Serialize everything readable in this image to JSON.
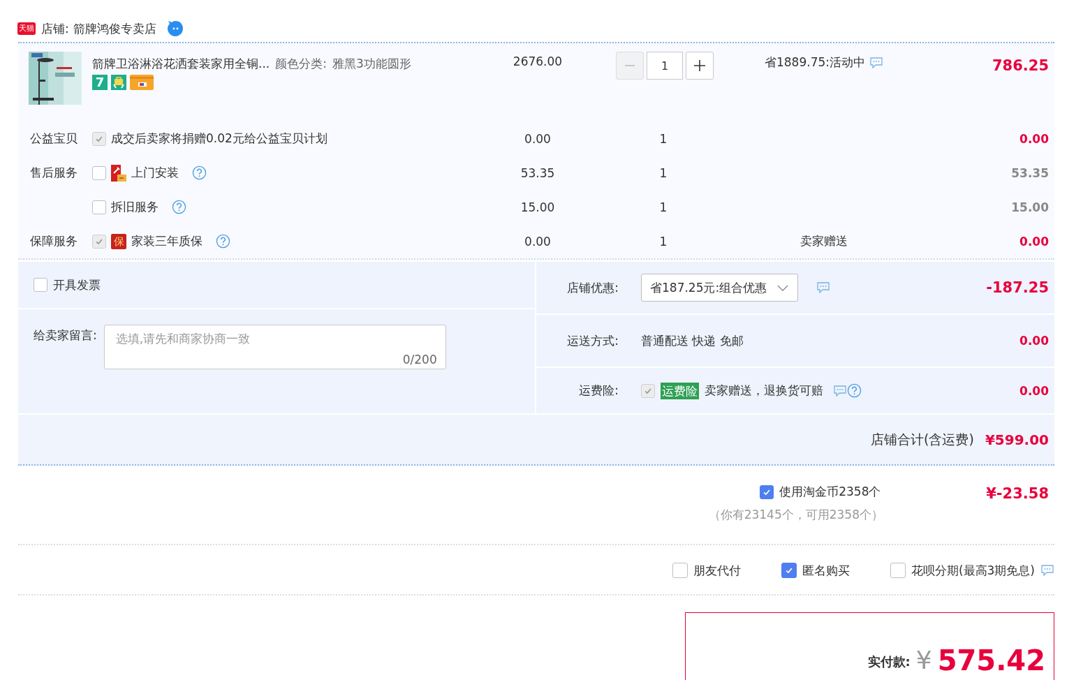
{
  "shop": {
    "badge": "天猫",
    "label": "店铺:",
    "name": "箭牌鸿俊专卖店"
  },
  "product": {
    "title": "箭牌卫浴淋浴花洒套装家用全铜...",
    "sku_label": "颜色分类:",
    "sku_value": "雅黑3功能圆形",
    "badge": "7",
    "price": "2676.00",
    "quantity": "1",
    "savings": "省1889.75:活动中",
    "total": "786.25"
  },
  "services": [
    {
      "group": "公益宝贝",
      "kind": "plain",
      "checked": true,
      "disabled": true,
      "label": "成交后卖家将捐赠0.02元给公益宝贝计划",
      "help": false,
      "price": "0.00",
      "quantity": "1",
      "total": "0.00"
    },
    {
      "group": "售后服务",
      "kind": "install",
      "checked": false,
      "disabled": false,
      "label": "上门安装",
      "help": true,
      "price": "53.35",
      "quantity": "1",
      "total": "53.35"
    },
    {
      "kind": "plain",
      "checked": false,
      "disabled": false,
      "label": "拆旧服务",
      "help": true,
      "price": "15.00",
      "quantity": "1",
      "total": "15.00"
    },
    {
      "group": "保障服务",
      "kind": "warranty",
      "badge": "保",
      "checked": true,
      "disabled": true,
      "label": "家装三年质保",
      "help": true,
      "price": "0.00",
      "quantity": "1",
      "note": "卖家赠送",
      "total": "0.00"
    }
  ],
  "invoice": {
    "label": "开具发票",
    "checked": false
  },
  "message": {
    "label": "给卖家留言:",
    "placeholder": "选填,请先和商家协商一致",
    "counter": "0/200"
  },
  "store_discount": {
    "label": "店铺优惠:",
    "value": "省187.25元:组合优惠",
    "amount": "-187.25"
  },
  "shipping": {
    "label": "运送方式:",
    "value": "普通配送 快递 免邮",
    "amount": "0.00"
  },
  "insurance": {
    "label": "运费险:",
    "checked": true,
    "disabled": true,
    "tag": "运费险",
    "text": "卖家赠送，退换货可赔",
    "amount": "0.00"
  },
  "shop_total": {
    "label": "店铺合计(含运费)",
    "amount": "¥599.00"
  },
  "coins": {
    "label": "使用淘金币2358个",
    "checked": true,
    "note": "（你有23145个，可用2358个）",
    "amount": "¥-23.58"
  },
  "options": [
    {
      "label": "朋友代付",
      "checked": false,
      "info": false
    },
    {
      "label": "匿名购买",
      "checked": true,
      "info": false
    },
    {
      "label": "花呗分期(最高3期免息)",
      "checked": false,
      "info": true
    }
  ],
  "payment": {
    "label": "实付款:",
    "currency": "¥",
    "amount": "575.42"
  }
}
